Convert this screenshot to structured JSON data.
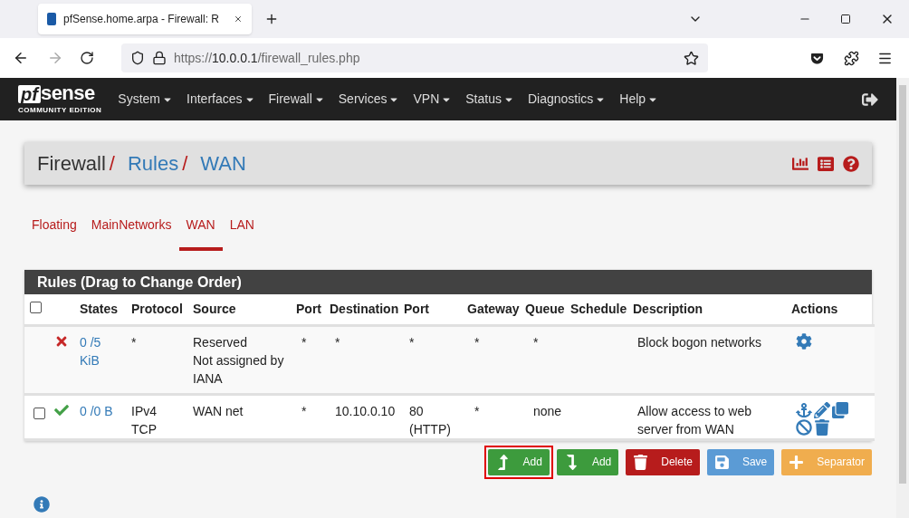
{
  "browser": {
    "tab_title": "pfSense.home.arpa - Firewall: R",
    "url": {
      "scheme": "https://",
      "host": "10.0.0.1",
      "path": "/firewall_rules.php"
    }
  },
  "logo": {
    "mark": "pf",
    "word": "sense",
    "edition": "COMMUNITY EDITION"
  },
  "nav": [
    "System",
    "Interfaces",
    "Firewall",
    "Services",
    "VPN",
    "Status",
    "Diagnostics",
    "Help"
  ],
  "breadcrumb": [
    {
      "label": "Firewall",
      "link": false
    },
    {
      "separator": "/",
      "label": "Rules",
      "link": true
    },
    {
      "separator": "/",
      "label": "WAN",
      "link": true
    }
  ],
  "tabs": [
    {
      "label": "Floating",
      "selected": false
    },
    {
      "label": "MainNetworks",
      "selected": false
    },
    {
      "label": "WAN",
      "selected": true
    },
    {
      "label": "LAN",
      "selected": false
    }
  ],
  "table": {
    "title": "Rules (Drag to Change Order)",
    "columns": [
      "States",
      "Protocol",
      "Source",
      "Port",
      "Destination",
      "Port",
      "Gateway",
      "Queue",
      "Schedule",
      "Description",
      "Actions"
    ],
    "header_checkbox": {
      "checked": false
    },
    "rows": [
      {
        "kind": "block",
        "states": [
          "0 /5",
          "KiB"
        ],
        "protocol": [
          "*"
        ],
        "source": [
          "Reserved",
          "Not assigned by",
          "IANA"
        ],
        "source_port": "*",
        "destination": "*",
        "port": [
          "*"
        ],
        "gateway": "*",
        "queue": "*",
        "description": [
          "Block bogon networks"
        ],
        "actions": [
          {
            "kind": "gear"
          }
        ]
      },
      {
        "kind": "pass",
        "checkbox": {
          "checked": false
        },
        "states": [
          "0 /0 B"
        ],
        "protocol": [
          "IPv4",
          "TCP"
        ],
        "source": [
          "WAN net"
        ],
        "source_port": "*",
        "destination": "10.10.0.10",
        "port": [
          "80",
          "(HTTP)"
        ],
        "gateway": "*",
        "queue": "none",
        "description": [
          "Allow access to web",
          "server from WAN"
        ],
        "actions": [
          {
            "kind": "anchor"
          },
          {
            "kind": "pencil"
          },
          {
            "kind": "copy"
          },
          {
            "kind": "ban"
          },
          {
            "kind": "trash"
          }
        ]
      }
    ]
  },
  "buttons": [
    {
      "kind": "add-top",
      "label": "Add",
      "highlighted": true
    },
    {
      "kind": "add-bottom",
      "label": "Add",
      "highlighted": false
    },
    {
      "kind": "delete",
      "label": "Delete",
      "highlighted": false
    },
    {
      "kind": "save",
      "label": "Save",
      "highlighted": false
    },
    {
      "kind": "separator",
      "label": "Separator",
      "highlighted": false
    }
  ]
}
